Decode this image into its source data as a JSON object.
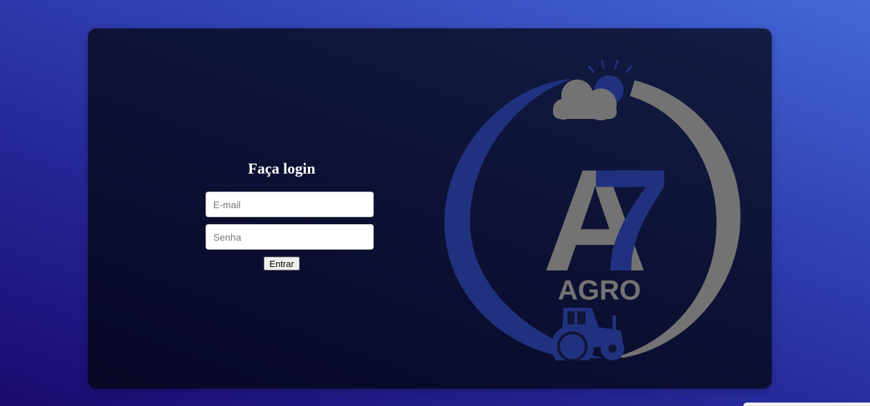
{
  "login": {
    "title": "Faça login",
    "email_placeholder": "E-mail",
    "password_placeholder": "Senha",
    "submit_label": "Entrar"
  },
  "logo": {
    "letter_a": "A",
    "digit_7": "7",
    "word": "AGRO"
  },
  "colors": {
    "brand_blue": "#20327f",
    "brand_gray": "#737373"
  }
}
